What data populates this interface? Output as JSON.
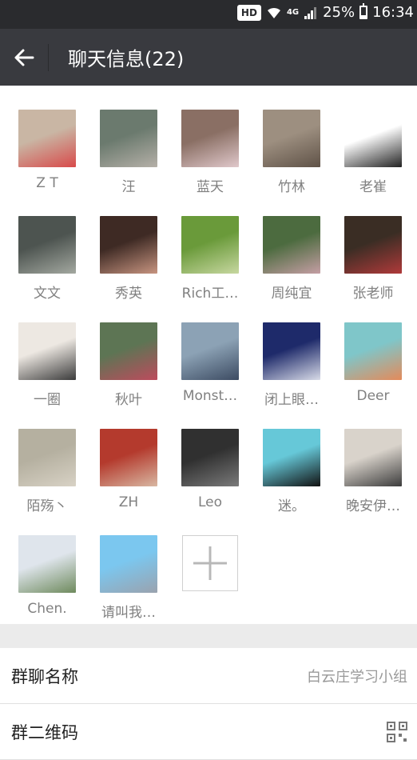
{
  "status_bar": {
    "hd": "HD",
    "network": "4G",
    "battery": "25%",
    "battery_level": 0.25,
    "time": "16:34"
  },
  "header": {
    "title": "聊天信息(22)"
  },
  "members": [
    {
      "name": "Z T",
      "colors": [
        "#c9b6a4",
        "#d84a4a"
      ]
    },
    {
      "name": "汪",
      "colors": [
        "#6b7a6e",
        "#b5b0a8"
      ]
    },
    {
      "name": "蓝天",
      "colors": [
        "#8a6f64",
        "#e0c8cb"
      ]
    },
    {
      "name": "竹林",
      "colors": [
        "#9d8f80",
        "#5f5247"
      ]
    },
    {
      "name": "老崔",
      "colors": [
        "#ffffff",
        "#222222"
      ]
    },
    {
      "name": "文文",
      "colors": [
        "#4d5450",
        "#a3a8a0"
      ]
    },
    {
      "name": "秀英",
      "colors": [
        "#3e2a24",
        "#c79480"
      ]
    },
    {
      "name": "Rich工…",
      "colors": [
        "#6a9a3a",
        "#c7d7a0"
      ]
    },
    {
      "name": "周纯宜",
      "colors": [
        "#4c6b3f",
        "#c59ea4"
      ]
    },
    {
      "name": "张老师",
      "colors": [
        "#3a2d24",
        "#b03a3a"
      ]
    },
    {
      "name": "一圈",
      "colors": [
        "#ede8e2",
        "#3b3b3b"
      ]
    },
    {
      "name": "秋叶",
      "colors": [
        "#5d7554",
        "#bd4b5d"
      ]
    },
    {
      "name": "Monst…",
      "colors": [
        "#8ca2b5",
        "#3c4b62"
      ]
    },
    {
      "name": "闭上眼…",
      "colors": [
        "#1e2a6a",
        "#d8dbe8"
      ]
    },
    {
      "name": "Deer",
      "colors": [
        "#7fc6c9",
        "#e48a5a"
      ]
    },
    {
      "name": "陌殇丶",
      "colors": [
        "#b5b0a0",
        "#d8d2c5"
      ]
    },
    {
      "name": "ZH",
      "colors": [
        "#b43a2d",
        "#d8b7a2"
      ]
    },
    {
      "name": "Leo",
      "colors": [
        "#303030",
        "#7a7a7a"
      ]
    },
    {
      "name": "迷。",
      "colors": [
        "#66c8d8",
        "#111111"
      ]
    },
    {
      "name": "晚安伊…",
      "colors": [
        "#d9d3cb",
        "#3c3c3c"
      ]
    },
    {
      "name": "Chen.",
      "colors": [
        "#dfe5ec",
        "#6e8a5d"
      ]
    },
    {
      "name": "请叫我…",
      "colors": [
        "#7bc7ef",
        "#9aa2ae"
      ]
    }
  ],
  "add_member": {
    "icon": "plus-icon"
  },
  "settings": [
    {
      "label": "群聊名称",
      "value": "白云庄学习小组"
    },
    {
      "label": "群二维码",
      "value": ""
    }
  ],
  "colors": {
    "status_bg": "#2a2b2e",
    "nav_bg": "#393a3f",
    "page_bg": "#ebebeb",
    "muted_text": "#808080"
  }
}
